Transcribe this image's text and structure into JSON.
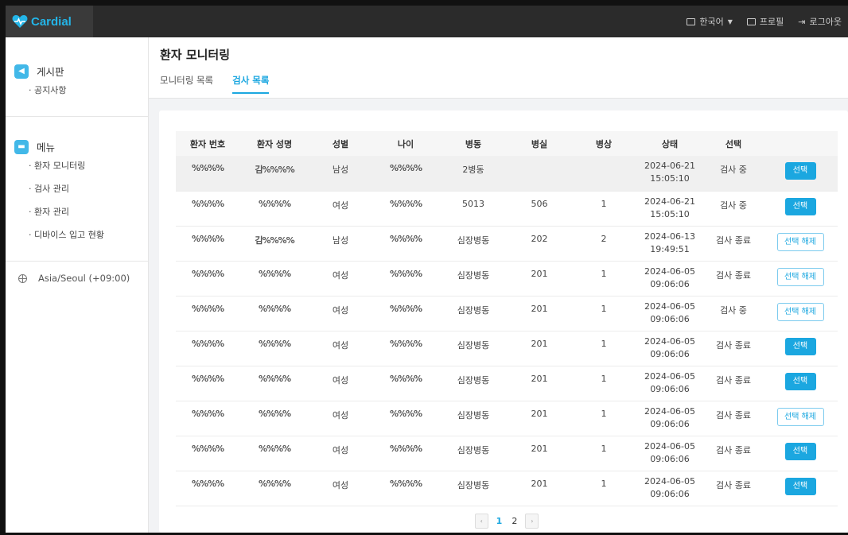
{
  "app": {
    "brand": "Cardial"
  },
  "topbar": {
    "language": "한국어",
    "profile": "프로필",
    "logout": "로그아웃"
  },
  "sidebar": {
    "board": {
      "title": "게시판",
      "items": [
        "· 공지사항"
      ]
    },
    "menu": {
      "title": "메뉴",
      "items": [
        "· 환자 모니터링",
        "· 검사 관리",
        "· 환자 관리",
        "· 디바이스 입고 현황"
      ]
    },
    "timezone": "Asia/Seoul (+09:00)"
  },
  "page": {
    "title": "환자 모니터링",
    "tabs": [
      {
        "label": "모니터링 목록",
        "active": false
      },
      {
        "label": "검사 목록",
        "active": true
      }
    ]
  },
  "table": {
    "columns": [
      "환자 번호",
      "환자 성명",
      "성별",
      "나이",
      "병동",
      "병실",
      "병상",
      "상태",
      "선택",
      ""
    ],
    "rows": [
      {
        "id": "%%%%",
        "name": "김%%%%",
        "sex": "남성",
        "age": "%%%%",
        "ward": "2병동",
        "room": "",
        "bed": "",
        "date": "2024-06-21",
        "time": "15:05:10",
        "status": "검사 중",
        "action": "선택",
        "selected": true
      },
      {
        "id": "%%%%",
        "name": "%%%%",
        "sex": "여성",
        "age": "%%%%",
        "ward": "5013",
        "room": "506",
        "bed": "1",
        "date": "2024-06-21",
        "time": "15:05:10",
        "status": "검사 중",
        "action": "선택",
        "selected": false
      },
      {
        "id": "%%%%",
        "name": "김%%%%",
        "sex": "남성",
        "age": "%%%%",
        "ward": "심장병동",
        "room": "202",
        "bed": "2",
        "date": "2024-06-13",
        "time": "19:49:51",
        "status": "검사 종료",
        "action": "선택 해제",
        "selected": false
      },
      {
        "id": "%%%%",
        "name": "%%%%",
        "sex": "여성",
        "age": "%%%%",
        "ward": "심장병동",
        "room": "201",
        "bed": "1",
        "date": "2024-06-05",
        "time": "09:06:06",
        "status": "검사 종료",
        "action": "선택 해제",
        "selected": false
      },
      {
        "id": "%%%%",
        "name": "%%%%",
        "sex": "여성",
        "age": "%%%%",
        "ward": "심장병동",
        "room": "201",
        "bed": "1",
        "date": "2024-06-05",
        "time": "09:06:06",
        "status": "검사 중",
        "action": "선택 해제",
        "selected": false
      },
      {
        "id": "%%%%",
        "name": "%%%%",
        "sex": "여성",
        "age": "%%%%",
        "ward": "심장병동",
        "room": "201",
        "bed": "1",
        "date": "2024-06-05",
        "time": "09:06:06",
        "status": "검사 종료",
        "action": "선택",
        "selected": false
      },
      {
        "id": "%%%%",
        "name": "%%%%",
        "sex": "여성",
        "age": "%%%%",
        "ward": "심장병동",
        "room": "201",
        "bed": "1",
        "date": "2024-06-05",
        "time": "09:06:06",
        "status": "검사 종료",
        "action": "선택",
        "selected": false
      },
      {
        "id": "%%%%",
        "name": "%%%%",
        "sex": "여성",
        "age": "%%%%",
        "ward": "심장병동",
        "room": "201",
        "bed": "1",
        "date": "2024-06-05",
        "time": "09:06:06",
        "status": "검사 종료",
        "action": "선택 해제",
        "selected": false
      },
      {
        "id": "%%%%",
        "name": "%%%%",
        "sex": "여성",
        "age": "%%%%",
        "ward": "심장병동",
        "room": "201",
        "bed": "1",
        "date": "2024-06-05",
        "time": "09:06:06",
        "status": "검사 종료",
        "action": "선택",
        "selected": false
      },
      {
        "id": "%%%%",
        "name": "%%%%",
        "sex": "여성",
        "age": "%%%%",
        "ward": "심장병동",
        "room": "201",
        "bed": "1",
        "date": "2024-06-05",
        "time": "09:06:06",
        "status": "검사 종료",
        "action": "선택",
        "selected": false
      }
    ]
  },
  "pagination": {
    "prev": "‹",
    "pages": [
      "1",
      "2"
    ],
    "current": "1",
    "next": "›"
  },
  "colors": {
    "accent": "#1ba7e0",
    "topbar": "#2b2b2b"
  }
}
